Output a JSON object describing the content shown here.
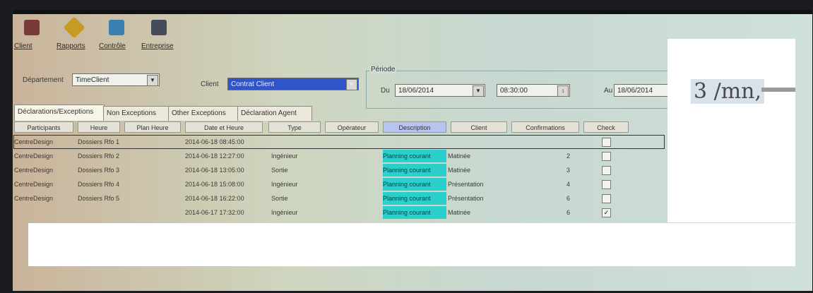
{
  "toolbar": {
    "items": [
      {
        "label": "Client",
        "icon": "client-icon",
        "color": "#7b3a3a"
      },
      {
        "label": "Rapports",
        "icon": "reports-icon",
        "color": "#c79a23"
      },
      {
        "label": "Contrôle",
        "icon": "control-icon",
        "color": "#3a7fb0"
      },
      {
        "label": "Entreprise",
        "icon": "company-icon",
        "color": "#444b5a"
      }
    ]
  },
  "filters": {
    "department_label": "Département",
    "department_value": "TimeClient",
    "client_label": "Client",
    "client_value": "Contrat Client",
    "period_label": "Période",
    "from_label": "Du",
    "from_date": "18/06/2014",
    "from_time": "08:30:00",
    "to_label": "Au",
    "to_date": "18/06/2014",
    "unit_text": "3 /mn,"
  },
  "tabs": [
    {
      "label": "Déclarations/Exceptions",
      "active": true
    },
    {
      "label": "Non Exceptions",
      "active": false
    },
    {
      "label": "Other Exceptions",
      "active": false
    },
    {
      "label": "Déclaration Agent",
      "active": false
    }
  ],
  "grid": {
    "headers": [
      "Participants",
      "Heure",
      "Plan Heure",
      "Date et Heure",
      "Type",
      "Opérateur",
      "Description",
      "Client",
      "Confirmations",
      "Check"
    ],
    "rows": [
      {
        "participant": "CentreDesign",
        "name": "Dossiers Rfo 1",
        "plan": "",
        "datetime": "2014-06-18 08:45:00",
        "type": "",
        "desc": "",
        "client": "",
        "conf": "",
        "check": false
      },
      {
        "participant": "CentreDesign",
        "name": "Dossiers Rfo 2",
        "plan": "",
        "datetime": "2014-06-18 12:27:00",
        "type": "Ingénieur",
        "desc": "Planning courant",
        "client": "Matinée",
        "conf": "2",
        "check": false
      },
      {
        "participant": "CentreDesign",
        "name": "Dossiers Rfo 3",
        "plan": "",
        "datetime": "2014-06-18 13:05:00",
        "type": "Sortie",
        "desc": "Planning courant",
        "client": "Matinée",
        "conf": "3",
        "check": false
      },
      {
        "participant": "CentreDesign",
        "name": "Dossiers Rfo 4",
        "plan": "",
        "datetime": "2014-06-18 15:08:00",
        "type": "Ingénieur",
        "desc": "Planning courant",
        "client": "Présentation",
        "conf": "4",
        "check": false
      },
      {
        "participant": "CentreDesign",
        "name": "Dossiers Rfo 5",
        "plan": "",
        "datetime": "2014-06-18 16:22:00",
        "type": "Sortie",
        "desc": "Planning courant",
        "client": "Présentation",
        "conf": "6",
        "check": false
      },
      {
        "participant": "",
        "name": "",
        "plan": "",
        "datetime": "2014-06-17 17:32:00",
        "type": "Ingénieur",
        "desc": "Planning courant",
        "client": "Matinée",
        "conf": "6",
        "check": true
      }
    ]
  }
}
